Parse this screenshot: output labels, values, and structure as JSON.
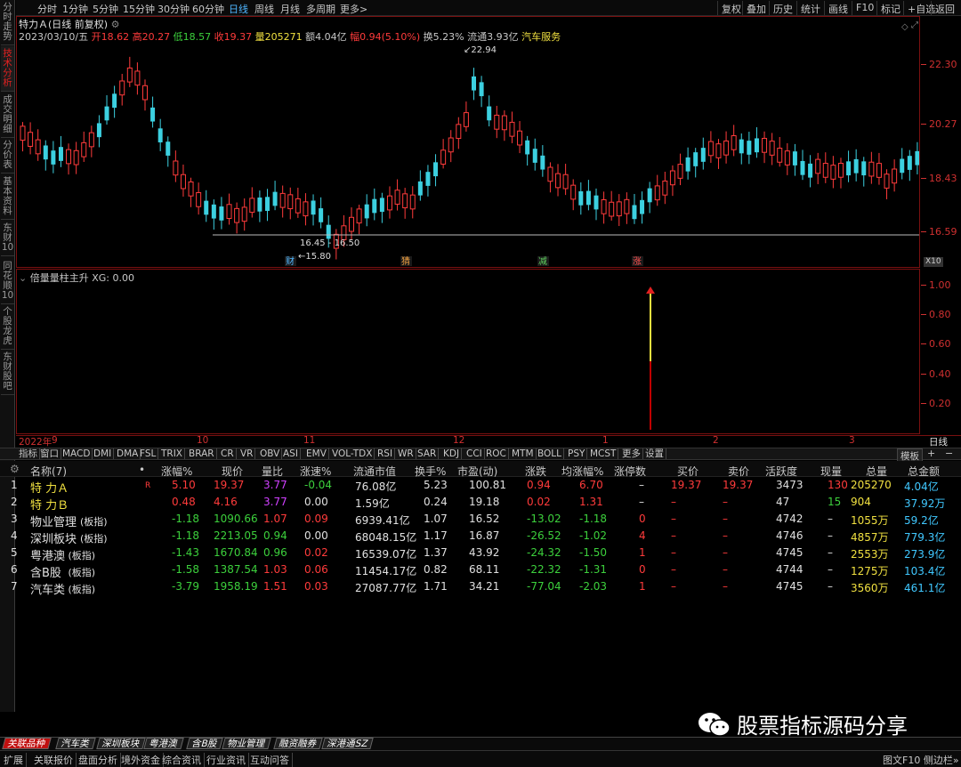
{
  "left_tabs": [
    "分时走势",
    "技术分析",
    "成交明细",
    "分价表",
    "基本资料",
    "东财10",
    "同花顺10",
    "个股龙虎",
    "东财股吧"
  ],
  "top_tabs": [
    "分时",
    "1分钟",
    "5分钟",
    "15分钟",
    "30分钟",
    "60分钟",
    "日线",
    "周线",
    "月线",
    "多周期",
    "更多>"
  ],
  "top_right": [
    "复权",
    "叠加",
    "历史",
    "统计",
    "画线",
    "F10",
    "标记",
    "+自选",
    "返回"
  ],
  "stock_title": "特力Ａ(日线 前复权)",
  "info_date": "2023/03/10/五",
  "info": {
    "open_label": "开",
    "open": "18.62",
    "high_label": "高",
    "high": "20.27",
    "low_label": "低",
    "low": "18.57",
    "close_label": "收",
    "close": "19.37",
    "vol_label": "量",
    "vol": "205271",
    "amt_label": "额",
    "amt": "4.04亿",
    "chg_label": "幅",
    "chg": "0.94(5.10%)",
    "turn": "换5.23%",
    "float": "流通3.93亿",
    "industry": "汽车服务"
  },
  "price_axis": [
    "22.30",
    "20.27",
    "18.43",
    "16.59"
  ],
  "sub_axis": [
    "1.00",
    "0.80",
    "0.60",
    "0.40",
    "0.20"
  ],
  "annotations": {
    "high": "22.94",
    "range": "16.45 - 16.50",
    "low": "15.80",
    "x10": "X10"
  },
  "markers": [
    "财",
    "猜",
    "减",
    "涨"
  ],
  "indicator_title": "倍量量柱主升 XG: 0.00",
  "xaxis": [
    "2022年",
    "9",
    "10",
    "11",
    "12",
    "1",
    "2",
    "3"
  ],
  "xaxis_right": "日线",
  "indicators": [
    "指标",
    "窗口",
    "MACD",
    "DMI",
    "DMA",
    "FSL",
    "TRIX",
    "BRAR",
    "CR",
    "VR",
    "OBV",
    "ASI",
    "EMV",
    "VOL-TDX",
    "RSI",
    "WR",
    "SAR",
    "KDJ",
    "CCI",
    "ROC",
    "MTM",
    "BOLL",
    "PSY",
    "MCST",
    "更多",
    "设置"
  ],
  "template_label": "模板",
  "table": {
    "headers": [
      "名称(7)",
      "•",
      "涨幅%",
      "现价",
      "量比",
      "涨速%",
      "流通市值",
      "换手%",
      "市盈(动)",
      "涨跌",
      "均涨幅%",
      "涨停数",
      "买价",
      "卖价",
      "活跃度",
      "现量",
      "总量",
      "总金额"
    ],
    "rows": [
      {
        "no": "1",
        "name": "特 力Ａ",
        "tag": "",
        "flag": "R",
        "chg": "5.10",
        "price": "19.37",
        "vr": "3.77",
        "spd": "-0.04",
        "mcap": "76.08亿",
        "turn": "5.23",
        "pe": "100.81",
        "diff": "0.94",
        "avg": "6.70",
        "limit": "–",
        "bid": "19.37",
        "ask": "19.37",
        "act": "3473",
        "cur": "130",
        "vol": "205270",
        "amt": "4.04亿"
      },
      {
        "no": "2",
        "name": "特 力Ｂ",
        "tag": "",
        "flag": "",
        "chg": "0.48",
        "price": "4.16",
        "vr": "3.77",
        "spd": "0.00",
        "mcap": "1.59亿",
        "turn": "0.24",
        "pe": "19.18",
        "diff": "0.02",
        "avg": "1.31",
        "limit": "–",
        "bid": "–",
        "ask": "–",
        "act": "47",
        "cur": "15",
        "vol": "904",
        "amt": "37.92万"
      },
      {
        "no": "3",
        "name": "物业管理",
        "tag": "(板指)",
        "flag": "",
        "chg": "-1.18",
        "price": "1090.66",
        "vr": "1.07",
        "spd": "0.09",
        "mcap": "6939.41亿",
        "turn": "1.07",
        "pe": "16.52",
        "diff": "-13.02",
        "avg": "-1.18",
        "limit": "0",
        "bid": "–",
        "ask": "–",
        "act": "4742",
        "cur": "–",
        "vol": "1055万",
        "amt": "59.2亿"
      },
      {
        "no": "4",
        "name": "深圳板块",
        "tag": "(板指)",
        "flag": "",
        "chg": "-1.18",
        "price": "2213.05",
        "vr": "0.94",
        "spd": "0.00",
        "mcap": "68048.15亿",
        "turn": "1.17",
        "pe": "16.87",
        "diff": "-26.52",
        "avg": "-1.02",
        "limit": "4",
        "bid": "–",
        "ask": "–",
        "act": "4746",
        "cur": "–",
        "vol": "4857万",
        "amt": "779.3亿"
      },
      {
        "no": "5",
        "name": "粤港澳",
        "tag": "(板指)",
        "flag": "",
        "chg": "-1.43",
        "price": "1670.84",
        "vr": "0.96",
        "spd": "0.02",
        "mcap": "16539.07亿",
        "turn": "1.37",
        "pe": "43.92",
        "diff": "-24.32",
        "avg": "-1.50",
        "limit": "1",
        "bid": "–",
        "ask": "–",
        "act": "4745",
        "cur": "–",
        "vol": "2553万",
        "amt": "273.9亿"
      },
      {
        "no": "6",
        "name": "含B股",
        "tag": "(板指)",
        "flag": "",
        "chg": "-1.58",
        "price": "1387.54",
        "vr": "1.03",
        "spd": "0.06",
        "mcap": "11454.17亿",
        "turn": "0.82",
        "pe": "68.11",
        "diff": "-22.32",
        "avg": "-1.31",
        "limit": "0",
        "bid": "–",
        "ask": "–",
        "act": "4744",
        "cur": "–",
        "vol": "1275万",
        "amt": "103.4亿"
      },
      {
        "no": "7",
        "name": "汽车类",
        "tag": "(板指)",
        "flag": "",
        "chg": "-3.79",
        "price": "1958.19",
        "vr": "1.51",
        "spd": "0.03",
        "mcap": "27087.77亿",
        "turn": "1.71",
        "pe": "34.21",
        "diff": "-77.04",
        "avg": "-2.03",
        "limit": "1",
        "bid": "–",
        "ask": "–",
        "act": "4745",
        "cur": "–",
        "vol": "3560万",
        "amt": "461.1亿"
      }
    ]
  },
  "bottom_tabs": [
    "关联品种",
    "汽车类",
    "深圳板块",
    "粤港澳",
    "含B股",
    "物业管理",
    "融资融券",
    "深港通SZ"
  ],
  "status_tabs": [
    "扩展",
    "关联报价",
    "盘面分析",
    "境外资金",
    "综合资讯",
    "行业资讯",
    "互动问答"
  ],
  "status_right": "图文F10 侧边栏»",
  "watermark": "股票指标源码分享",
  "colors": {
    "up": "#ff3b3b",
    "down": "#3cd0e0",
    "frame": "#7a1010"
  }
}
